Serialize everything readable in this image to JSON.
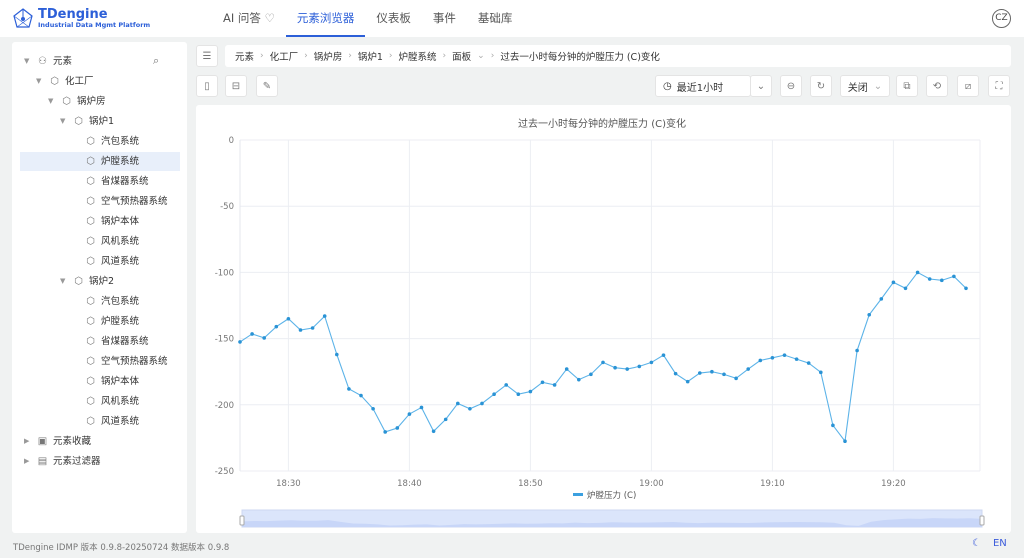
{
  "header": {
    "logo_title": "TDengine",
    "logo_subtitle": "Industrial Data Mgmt Platform",
    "nav": [
      {
        "label": "AI 问答"
      },
      {
        "label": "元素浏览器"
      },
      {
        "label": "仪表板"
      },
      {
        "label": "事件"
      },
      {
        "label": "基础库"
      }
    ],
    "active_nav": "元素浏览器",
    "avatar": "CZ"
  },
  "sidebar": {
    "root": "元素",
    "items": [
      {
        "label": "化工厂",
        "level": 1
      },
      {
        "label": "锅炉房",
        "level": 2
      },
      {
        "label": "锅炉1",
        "level": 3
      },
      {
        "label": "汽包系统",
        "level": 4
      },
      {
        "label": "炉膛系统",
        "level": 4,
        "selected": true
      },
      {
        "label": "省煤器系统",
        "level": 4
      },
      {
        "label": "空气预热器系统",
        "level": 4
      },
      {
        "label": "锅炉本体",
        "level": 4
      },
      {
        "label": "风机系统",
        "level": 4
      },
      {
        "label": "风道系统",
        "level": 4
      },
      {
        "label": "锅炉2",
        "level": 3
      },
      {
        "label": "汽包系统",
        "level": 4
      },
      {
        "label": "炉膛系统",
        "level": 4
      },
      {
        "label": "省煤器系统",
        "level": 4
      },
      {
        "label": "空气预热器系统",
        "level": 4
      },
      {
        "label": "锅炉本体",
        "level": 4
      },
      {
        "label": "风机系统",
        "level": 4
      },
      {
        "label": "风道系统",
        "level": 4
      }
    ],
    "favorites": "元素收藏",
    "filters": "元素过滤器"
  },
  "breadcrumb": [
    "元素",
    "化工厂",
    "锅炉房",
    "锅炉1",
    "炉膛系统",
    "面板",
    "过去一小时每分钟的炉膛压力 (C)变化"
  ],
  "toolbar": {
    "time_range": "最近1小时",
    "refresh": "关闭"
  },
  "footer": {
    "version": "TDengine IDMP 版本 0.9.8-20250724 数据版本 0.9.8",
    "lang": "EN"
  },
  "colors": {
    "accent": "#2c5fd8",
    "series": "#3ba0e0"
  },
  "chart_data": {
    "type": "line",
    "title": "过去一小时每分钟的炉膛压力 (C)变化",
    "legend": [
      "炉膛压力 (C)"
    ],
    "legend_position": "bottom",
    "x_start": "18:26",
    "x_step_minutes": 1,
    "x_ticks": [
      "18:30",
      "18:40",
      "18:50",
      "19:00",
      "19:10",
      "19:20"
    ],
    "y_ticks": [
      0,
      -50,
      -100,
      -150,
      -200,
      -250
    ],
    "ylim": [
      -250,
      0
    ],
    "series": [
      {
        "name": "炉膛压力 (C)",
        "values": [
          -152.5,
          -146.5,
          -149.5,
          -141,
          -135,
          -143.5,
          -142,
          -133,
          -162,
          -188,
          -193,
          -203,
          -220.5,
          -217.5,
          -207,
          -202,
          -220,
          -211,
          -199,
          -203,
          -199,
          -192,
          -185,
          -192,
          -190,
          -183,
          -185,
          -173,
          -181,
          -177,
          -168,
          -172,
          -173,
          -171,
          -168,
          -162.5,
          -176.5,
          -182.5,
          -176,
          -175,
          -177,
          -180,
          -173,
          -166.5,
          -164.5,
          -162.5,
          -165.5,
          -168.5,
          -175.5,
          -215.5,
          -227.5,
          -159,
          -132,
          -120,
          -107.5,
          -112,
          -100,
          -105,
          -106,
          -103,
          -112
        ]
      }
    ]
  }
}
